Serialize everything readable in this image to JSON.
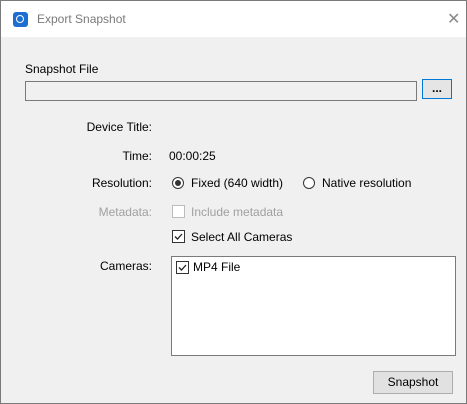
{
  "window": {
    "title": "Export Snapshot",
    "close_glyph": "✕",
    "icon": "app-logo-icon"
  },
  "snapshot_file": {
    "label": "Snapshot File",
    "value": "",
    "browse_label": "..."
  },
  "fields": {
    "device_title_label": "Device Title:",
    "device_title_value": "",
    "time_label": "Time:",
    "time_value": "00:00:25",
    "resolution_label": "Resolution:",
    "resolution_options": [
      {
        "label": "Fixed (640 width)",
        "selected": true
      },
      {
        "label": "Native resolution",
        "selected": false
      }
    ],
    "metadata_label": "Metadata:",
    "include_metadata_label": "Include metadata",
    "include_metadata_checked": false,
    "include_metadata_enabled": false,
    "select_all_label": "Select All Cameras",
    "select_all_checked": true,
    "cameras_label": "Cameras:",
    "cameras": [
      {
        "label": "MP4 File",
        "checked": true
      }
    ]
  },
  "buttons": {
    "snapshot_label": "Snapshot"
  }
}
